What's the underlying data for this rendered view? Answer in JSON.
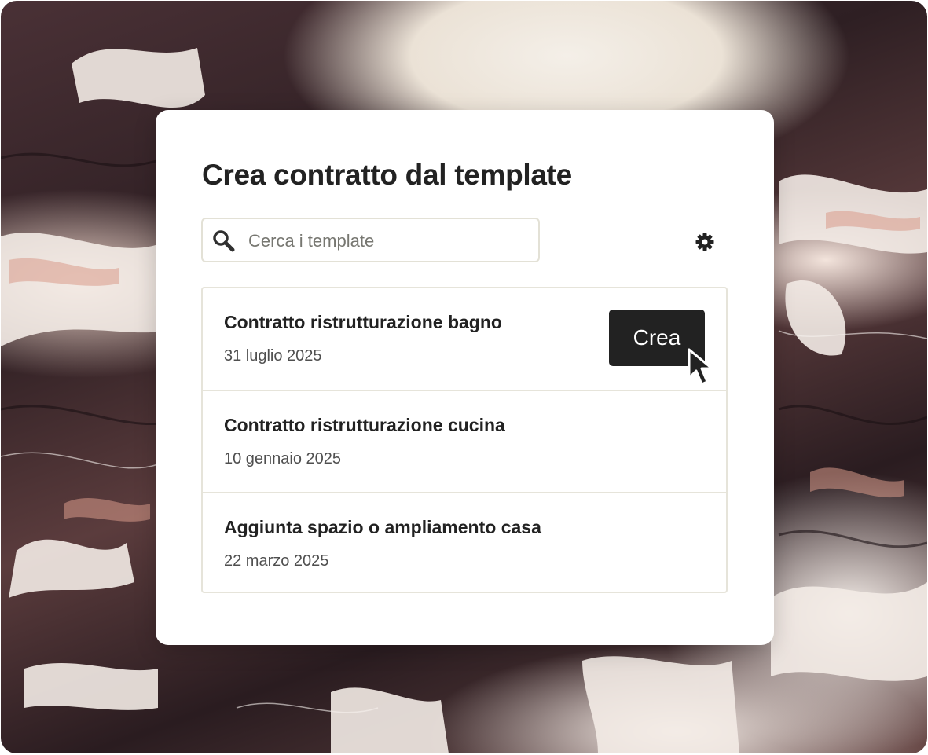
{
  "dialog": {
    "title": "Crea contratto dal template",
    "search": {
      "placeholder": "Cerca i template",
      "icon": "search-icon"
    },
    "settings_icon": "gear-icon"
  },
  "templates": [
    {
      "name": "Contratto ristrutturazione bagno",
      "date": "31 luglio 2025",
      "action": "Crea"
    },
    {
      "name": "Contratto ristrutturazione cucina",
      "date": "10 gennaio 2025"
    },
    {
      "name": "Aggiunta spazio o ampliamento casa",
      "date": "22 marzo 2025"
    }
  ],
  "colors": {
    "button_bg": "#222222",
    "text_primary": "#222222",
    "border": "#e6e4da",
    "dialog_bg": "#ffffff"
  }
}
